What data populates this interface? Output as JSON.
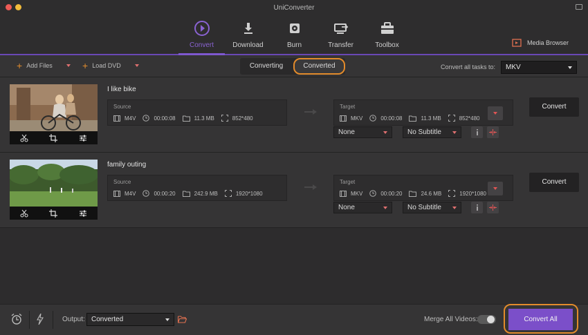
{
  "window": {
    "title": "UniConverter"
  },
  "nav": {
    "items": [
      {
        "label": "Convert",
        "icon": "convert-icon",
        "active": true
      },
      {
        "label": "Download",
        "icon": "download-icon"
      },
      {
        "label": "Burn",
        "icon": "burn-disc-icon"
      },
      {
        "label": "Transfer",
        "icon": "transfer-icon"
      },
      {
        "label": "Toolbox",
        "icon": "toolbox-icon"
      }
    ],
    "media_browser": "Media Browser"
  },
  "toolbar": {
    "add_files": "Add Files",
    "load_dvd": "Load DVD",
    "tabs": {
      "converting": "Converting",
      "converted": "Converted"
    },
    "convert_all_tasks_label": "Convert all tasks to:",
    "convert_all_tasks_value": "MKV"
  },
  "tasks": [
    {
      "title": "I like bike",
      "source": {
        "label": "Source",
        "format": "M4V",
        "duration": "00:00:08",
        "size": "11.3 MB",
        "resolution": "852*480"
      },
      "target": {
        "label": "Target",
        "format": "MKV",
        "duration": "00:00:08",
        "size": "11.3 MB",
        "resolution": "852*480"
      },
      "audio": "None",
      "subtitle": "No Subtitle",
      "convert_label": "Convert"
    },
    {
      "title": "family outing",
      "source": {
        "label": "Source",
        "format": "M4V",
        "duration": "00:00:20",
        "size": "242.9 MB",
        "resolution": "1920*1080"
      },
      "target": {
        "label": "Target",
        "format": "MKV",
        "duration": "00:00:20",
        "size": "24.6 MB",
        "resolution": "1920*1080"
      },
      "audio": "None",
      "subtitle": "No Subtitle",
      "convert_label": "Convert"
    }
  ],
  "bottom": {
    "output_label": "Output:",
    "output_value": "Converted",
    "merge_label": "Merge All Videos:",
    "merge_on": false,
    "convert_all": "Convert All"
  },
  "colors": {
    "accent": "#7b4fc9",
    "highlight": "#e38b2b",
    "add": "#e08b2d"
  }
}
